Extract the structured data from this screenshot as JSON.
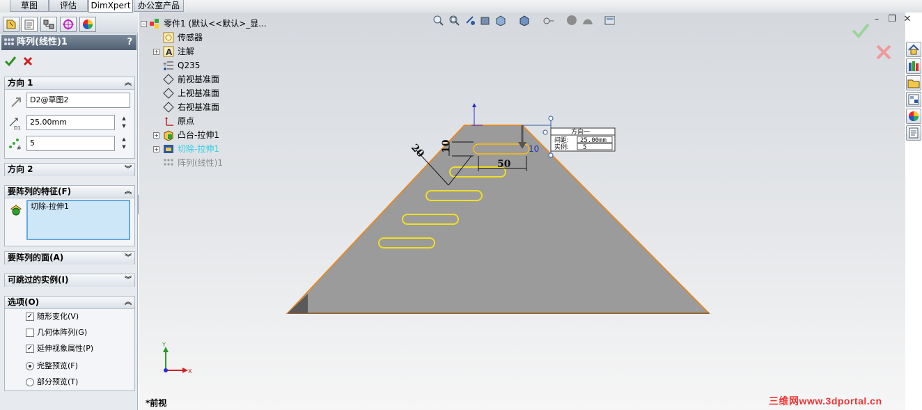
{
  "command_tabs": [
    "草图",
    "评估",
    "DimXpert",
    "办公室产品"
  ],
  "active_tab": "DimXpert",
  "property_manager": {
    "title": "阵列(线性)1",
    "help": "?",
    "direction1": {
      "label": "方向 1",
      "reference": "D2@草图2",
      "spacing": "25.00mm",
      "instances": "5"
    },
    "direction2": {
      "label": "方向 2"
    },
    "features_to_pattern": {
      "label": "要阵列的特征(F)",
      "items": [
        "切除-拉伸1"
      ]
    },
    "faces_to_pattern": {
      "label": "要阵列的面(A)"
    },
    "instances_to_skip": {
      "label": "可跳过的实例(I)"
    },
    "options": {
      "label": "选项(O)",
      "items": [
        {
          "label": "随形变化(V)",
          "type": "checkbox",
          "checked": true
        },
        {
          "label": "几何体阵列(G)",
          "type": "checkbox",
          "checked": false
        },
        {
          "label": "延伸视象属性(P)",
          "type": "checkbox",
          "checked": true
        },
        {
          "label": "完整预览(F)",
          "type": "radio",
          "checked": true
        },
        {
          "label": "部分预览(T)",
          "type": "radio",
          "checked": false
        }
      ]
    }
  },
  "feature_tree": {
    "root": "零件1 (默认<<默认>_显...",
    "items": [
      {
        "label": "传感器",
        "expandable": false,
        "icon": "sensor-icon"
      },
      {
        "label": "注解",
        "expandable": true,
        "icon": "annotation-icon"
      },
      {
        "label": "Q235",
        "expandable": false,
        "icon": "material-icon"
      },
      {
        "label": "前视基准面",
        "expandable": false,
        "icon": "plane-icon"
      },
      {
        "label": "上视基准面",
        "expandable": false,
        "icon": "plane-icon"
      },
      {
        "label": "右视基准面",
        "expandable": false,
        "icon": "plane-icon"
      },
      {
        "label": "原点",
        "expandable": false,
        "icon": "origin-icon"
      },
      {
        "label": "凸台-拉伸1",
        "expandable": true,
        "icon": "extrude-icon"
      },
      {
        "label": "切除-拉伸1",
        "expandable": true,
        "icon": "cut-extrude-icon",
        "highlight": true
      },
      {
        "label": "阵列(线性)1",
        "expandable": false,
        "icon": "linear-pattern-icon",
        "greyed": true
      }
    ]
  },
  "callout": {
    "title": "方向一",
    "spacing_label": "间距:",
    "spacing_value": "25.00mm",
    "instances_label": "实例:",
    "instances_value": "5"
  },
  "dimensions": {
    "angle_dim": "20",
    "height_dim": "10",
    "length_dim": "50",
    "right_dim": "10"
  },
  "triad": {
    "x": "X",
    "y": "Y"
  },
  "view_label": "*前视",
  "watermark": "三维网www.3dportal.cn",
  "colors": {
    "part_fill": "#9b9b9b",
    "edge": "#e08a2a",
    "preview": "#f0e020",
    "highlight_text": "#2ad0e6",
    "ok_green": "#3a9a2a",
    "cancel_red": "#d02020"
  }
}
